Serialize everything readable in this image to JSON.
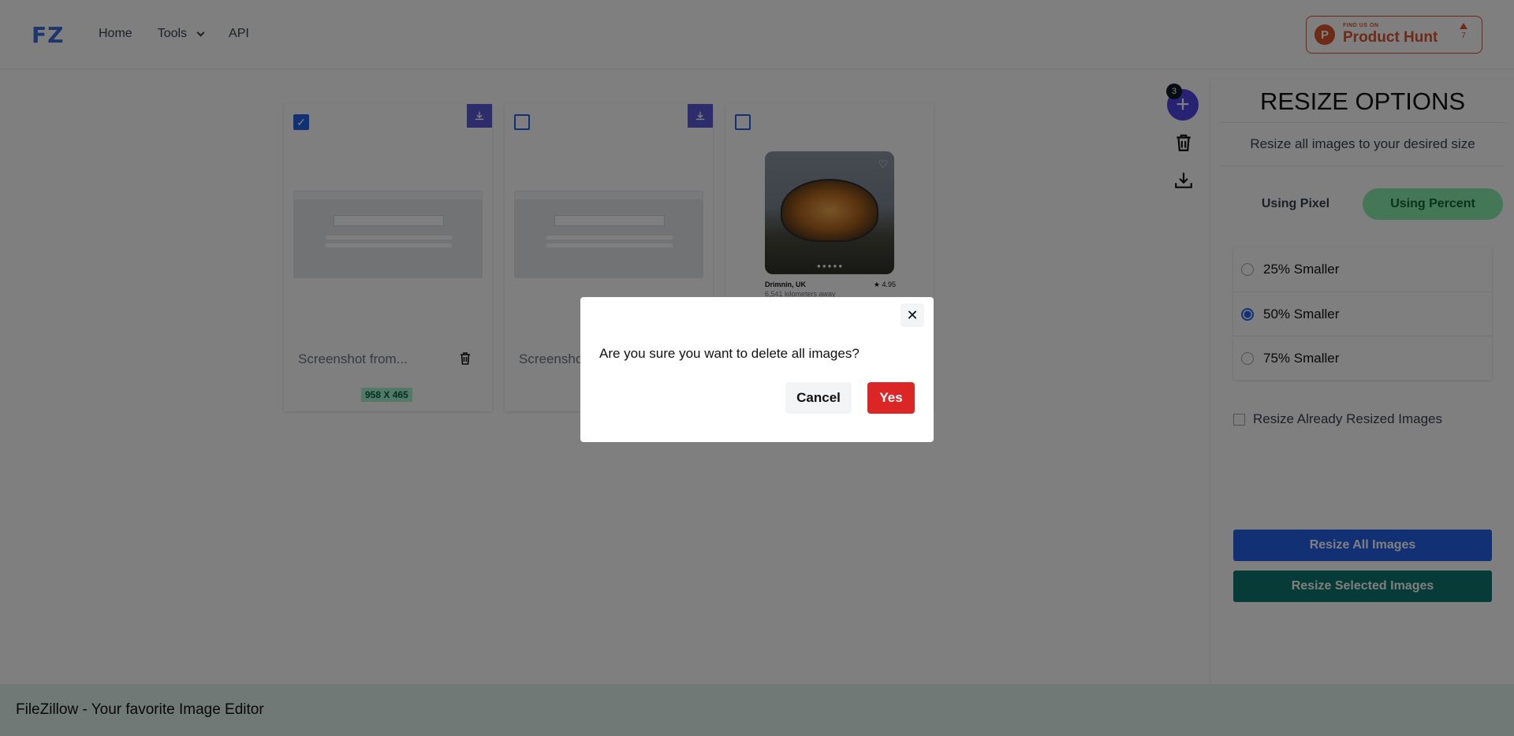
{
  "header": {
    "logo": "FZ",
    "nav": [
      {
        "label": "Home"
      },
      {
        "label": "Tools"
      },
      {
        "label": "API"
      }
    ],
    "product_hunt": {
      "small": "FIND US ON",
      "big": "Product Hunt",
      "votes": "7"
    }
  },
  "cards": [
    {
      "name": "Screenshot from...",
      "dims": "958 X 465",
      "checked": true
    },
    {
      "name": "Screenshot from...",
      "checked": false
    },
    {
      "place": "Drimnin, UK",
      "rating": "★ 4.95",
      "distance": "6,541 kilometers away",
      "checked": false
    }
  ],
  "actions": {
    "count": "3"
  },
  "panel": {
    "title": "RESIZE OPTIONS",
    "subtitle": "Resize all images to your desired size",
    "tabs": [
      {
        "label": "Using Pixel",
        "active": false
      },
      {
        "label": "Using Percent",
        "active": true
      }
    ],
    "options": [
      {
        "label": "25% Smaller",
        "selected": false
      },
      {
        "label": "50% Smaller",
        "selected": true
      },
      {
        "label": "75% Smaller",
        "selected": false
      }
    ],
    "checkbox_label": "Resize Already Resized Images",
    "resize_all": "Resize All Images",
    "resize_selected": "Resize Selected Images",
    "colors": {
      "resize_all": "#2563eb",
      "resize_selected": "#0f766e"
    }
  },
  "footer": {
    "text": "FileZillow - Your favorite Image Editor"
  },
  "modal": {
    "message": "Are you sure you want to delete all images?",
    "cancel": "Cancel",
    "yes": "Yes",
    "yes_color": "#dc2626"
  }
}
